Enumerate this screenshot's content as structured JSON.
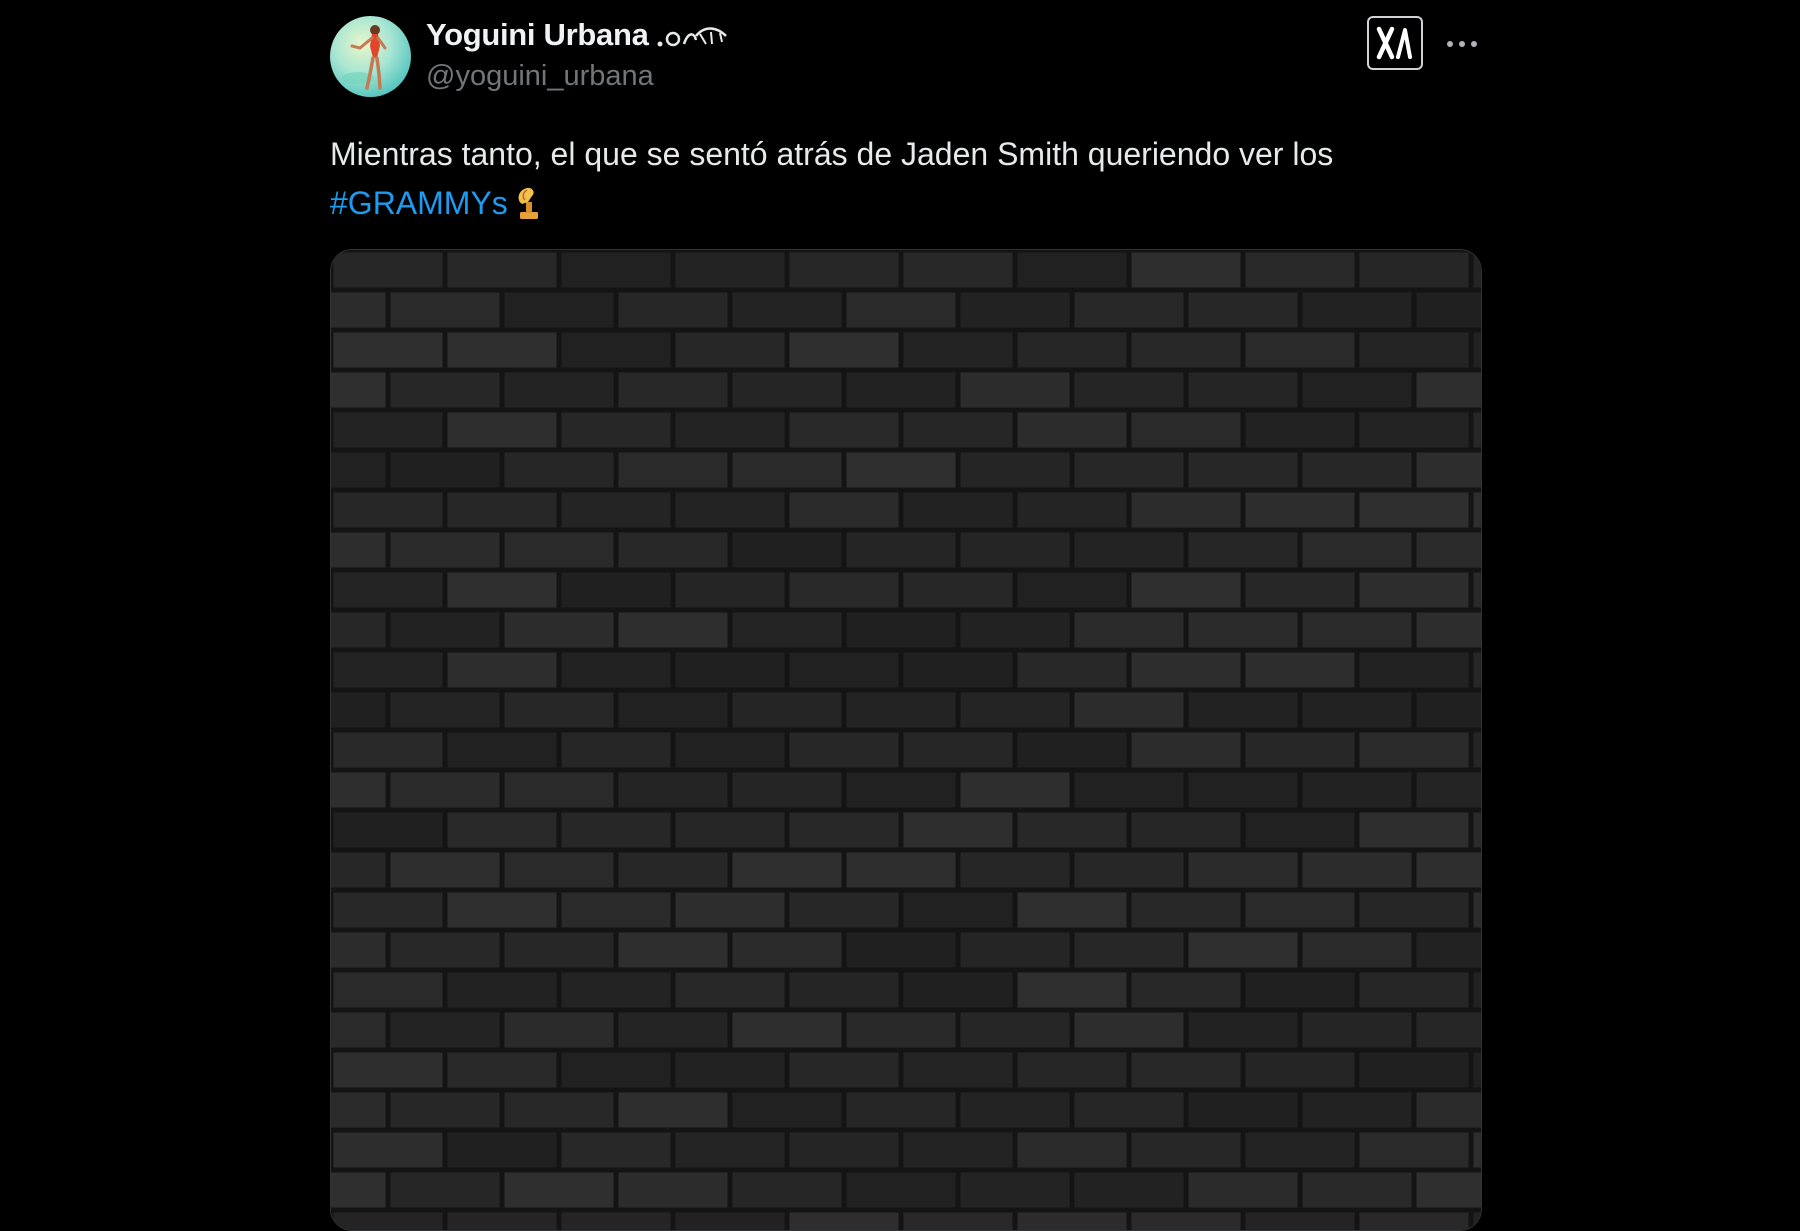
{
  "tweet": {
    "author": {
      "display_name": "Yoguini Urbana",
      "handle": "@yoguini_urbana",
      "avatar_icon": "avatar-photo",
      "name_decoration_icon": "ornament-icon"
    },
    "text_line_1": "Mientras tanto, el que se sentó atrás de Jaden Smith queriendo ver los",
    "hashtag": "#GRAMMYs",
    "emoji_icon": "gramophone-trophy-icon",
    "media": {
      "description_icon": "brick-wall-image"
    },
    "actions": {
      "logo_icon": "x-logo-icon",
      "more_icon": "more-options-icon"
    }
  },
  "colors": {
    "background": "#000000",
    "text": "#e7e9ea",
    "secondary_text": "#71767b",
    "hashtag": "#1d9bf0"
  }
}
